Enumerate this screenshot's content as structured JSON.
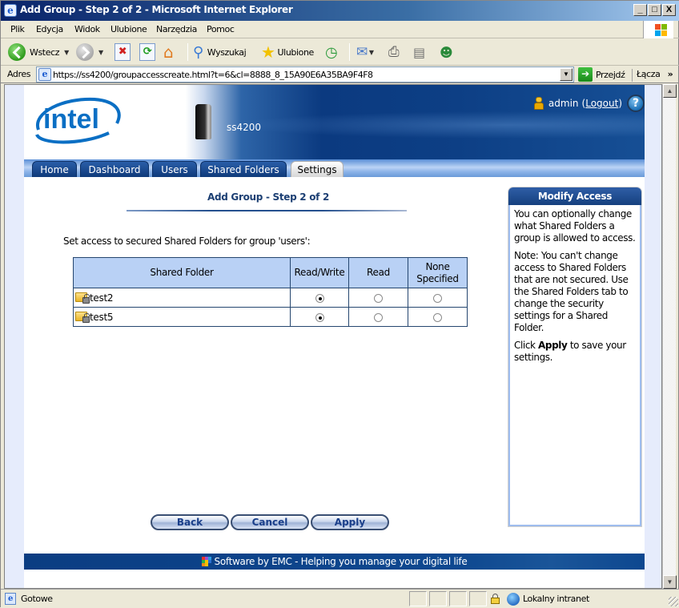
{
  "window": {
    "title": "Add Group - Step 2 of 2 - Microsoft Internet Explorer",
    "controls": {
      "minimize": "_",
      "maximize": "□",
      "close": "X"
    }
  },
  "menu": {
    "items": [
      {
        "label": "Plik",
        "accel": "P"
      },
      {
        "label": "Edycja",
        "accel": "E"
      },
      {
        "label": "Widok",
        "accel": "W"
      },
      {
        "label": "Ulubione",
        "accel": "U"
      },
      {
        "label": "Narzędzia",
        "accel": "N"
      },
      {
        "label": "Pomoc",
        "accel": "c"
      }
    ]
  },
  "toolbar": {
    "back_label": "Wstecz",
    "search_label": "Wyszukaj",
    "favorites_label": "Ulubione"
  },
  "address": {
    "label": "Adres",
    "url": "https://ss4200/groupaccesscreate.html?t=6&cl=8888_8_15A90E6A35BA9F4F8",
    "go_label": "Przejdź",
    "links_label": "Łącza"
  },
  "header": {
    "brand": "intel",
    "device_name": "ss4200",
    "username": "admin",
    "logout_label": "Logout",
    "help_label": "?"
  },
  "tabs": [
    {
      "label": "Home",
      "active": false
    },
    {
      "label": "Dashboard",
      "active": false
    },
    {
      "label": "Users",
      "active": false
    },
    {
      "label": "Shared Folders",
      "active": false
    },
    {
      "label": "Settings",
      "active": true
    }
  ],
  "main": {
    "wizard_title": "Add Group - Step 2 of 2",
    "instruction": "Set access to secured Shared Folders for group 'users':",
    "table": {
      "headers": [
        "Shared Folder",
        "Read/Write",
        "Read",
        "None Specified"
      ],
      "rows": [
        {
          "folder": "test2",
          "access": "Read/Write"
        },
        {
          "folder": "test5",
          "access": "Read/Write"
        }
      ]
    },
    "buttons": {
      "back": "Back",
      "cancel": "Cancel",
      "apply": "Apply"
    }
  },
  "side_panel": {
    "title": "Modify Access",
    "para1": "You can optionally change what Shared Folders a group is allowed to access.",
    "para2": "Note: You can't change access to Shared Folders that are not secured. Use the Shared Folders tab to change the security settings for a Shared Folder.",
    "para3_prefix": "Click ",
    "para3_bold": "Apply",
    "para3_suffix": " to save your settings."
  },
  "footer": {
    "text": "Software by EMC - Helping you manage your digital life"
  },
  "status": {
    "text": "Gotowe",
    "zone": "Lokalny intranet"
  }
}
